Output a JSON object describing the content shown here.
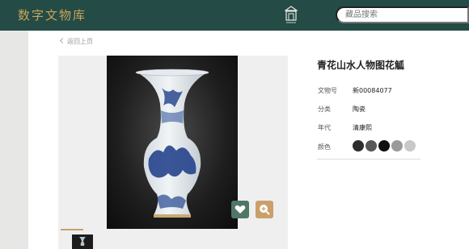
{
  "header": {
    "logo_text": "数字文物库",
    "search_placeholder": "藏品搜索",
    "emblem_icon": "museum-emblem-icon"
  },
  "nav": {
    "back_label": "返回上页"
  },
  "artifact": {
    "title": "青花山水人物图花觚",
    "fields": [
      {
        "label": "文物号",
        "value": "新00084077"
      },
      {
        "label": "分类",
        "value": "陶瓷"
      },
      {
        "label": "年代",
        "value": "清康熙"
      },
      {
        "label": "颜色",
        "value": ""
      }
    ],
    "colors": [
      "#2e2e2e",
      "#575757",
      "#111111",
      "#9a9a9a",
      "#c8c8c8"
    ]
  },
  "actions": {
    "favorite_icon": "heart-icon",
    "zoom_icon": "zoom-in-icon"
  },
  "theme": {
    "header_bg": "#244b45",
    "logo_color": "#c9a45c",
    "favorite_bg": "#4f7768",
    "zoom_bg": "#c9a06a"
  }
}
